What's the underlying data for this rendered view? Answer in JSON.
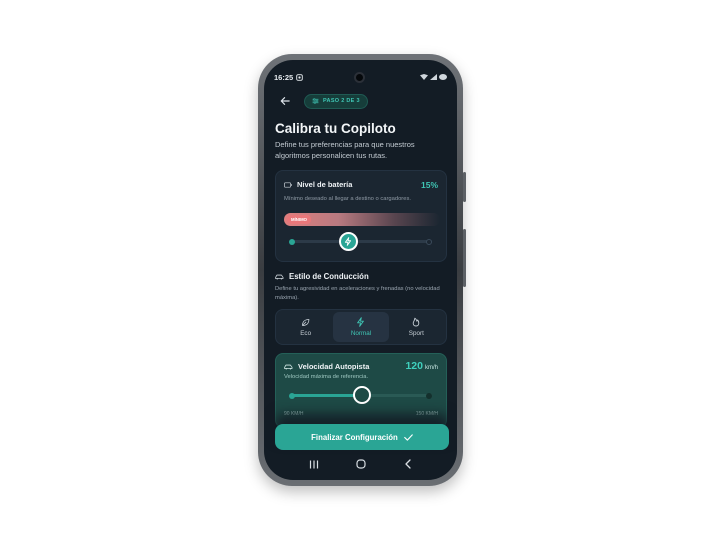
{
  "status_bar": {
    "time": "16:25"
  },
  "header": {
    "step_label": "PASO 2 DE 3"
  },
  "page": {
    "title": "Calibra tu Copiloto",
    "subtitle": "Define tus preferencias para que nuestros algoritmos personalicen tus rutas."
  },
  "battery": {
    "title": "Nivel de batería",
    "percent": "15%",
    "description": "Mínimo deseado al llegar a destino o cargadores.",
    "badge": "MÍNIMO",
    "slider_fraction": 0.4
  },
  "driving_style": {
    "title": "Estilo de Conducción",
    "description": "Define tu agresividad en aceleraciones y frenadas (no velocidad máxima).",
    "options": [
      {
        "label": "Eco",
        "icon": "leaf-icon"
      },
      {
        "label": "Normal",
        "icon": "bolt-icon"
      },
      {
        "label": "Sport",
        "icon": "flame-icon"
      }
    ],
    "selected": "Normal"
  },
  "highway_speed": {
    "title": "Velocidad Autopista",
    "value": "120",
    "unit": "km/h",
    "description": "Velocidad máxima de referencia.",
    "min_label": "90 KM/H",
    "max_label": "150 KM/H",
    "slider_fraction": 0.5
  },
  "cta": {
    "label": "Finalizar Configuración"
  },
  "colors": {
    "accent": "#2aa595",
    "background": "#131c25",
    "card": "#1b2631",
    "warning": "#e9777a"
  }
}
